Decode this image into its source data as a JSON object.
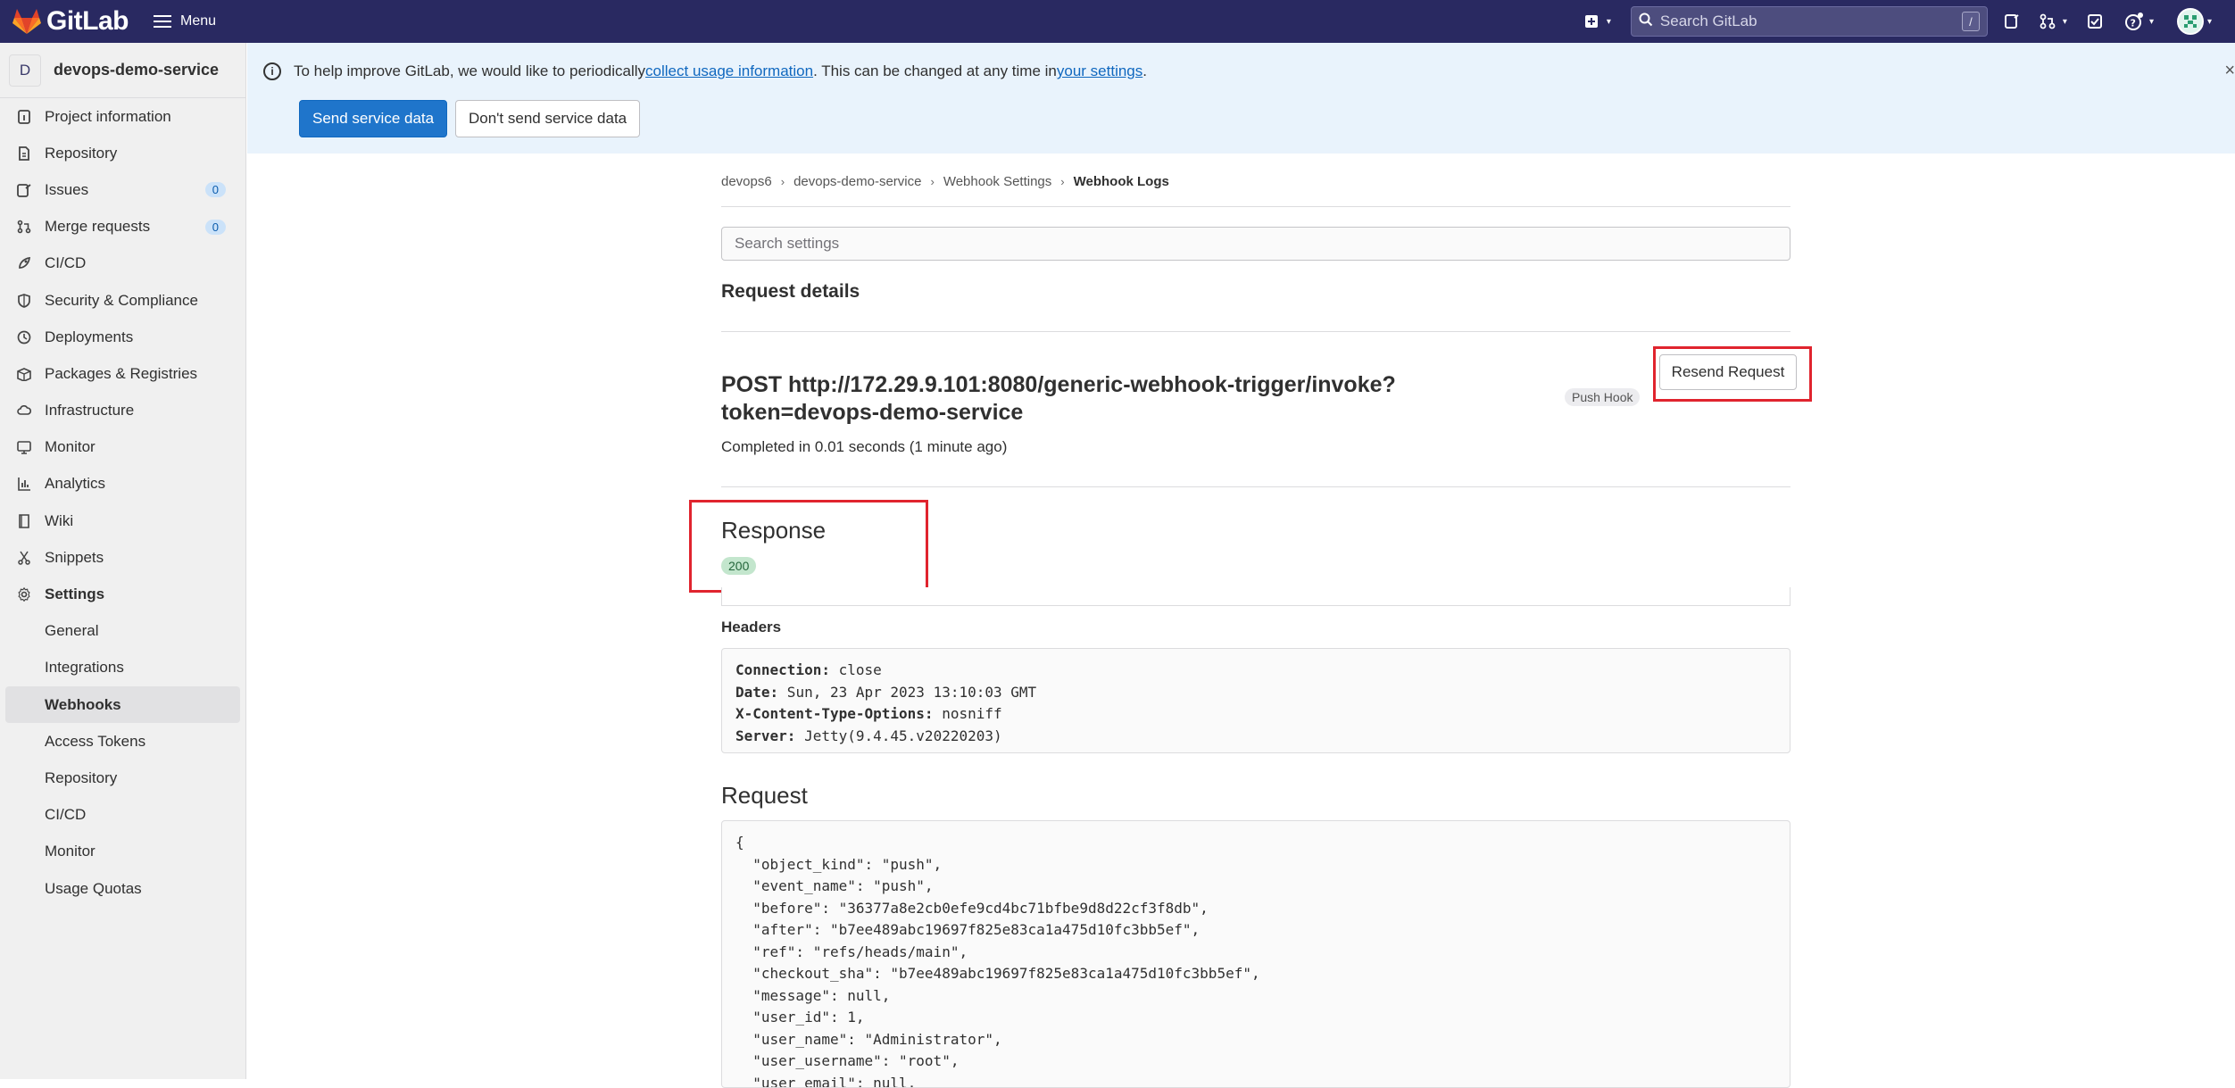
{
  "navbar": {
    "brand": "GitLab",
    "menu_label": "Menu",
    "search_placeholder": "Search GitLab",
    "search_shortcut": "/"
  },
  "sidebar": {
    "project_initial": "D",
    "project_name": "devops-demo-service",
    "items": [
      {
        "label": "Project information",
        "icon": "info-doc-icon"
      },
      {
        "label": "Repository",
        "icon": "doc-icon"
      },
      {
        "label": "Issues",
        "icon": "issues-icon",
        "badge": "0"
      },
      {
        "label": "Merge requests",
        "icon": "merge-request-icon",
        "badge": "0"
      },
      {
        "label": "CI/CD",
        "icon": "rocket-icon"
      },
      {
        "label": "Security & Compliance",
        "icon": "shield-icon"
      },
      {
        "label": "Deployments",
        "icon": "deployments-icon"
      },
      {
        "label": "Packages & Registries",
        "icon": "package-icon"
      },
      {
        "label": "Infrastructure",
        "icon": "cloud-gear-icon"
      },
      {
        "label": "Monitor",
        "icon": "monitor-icon"
      },
      {
        "label": "Analytics",
        "icon": "chart-icon"
      },
      {
        "label": "Wiki",
        "icon": "book-icon"
      },
      {
        "label": "Snippets",
        "icon": "scissors-icon"
      },
      {
        "label": "Settings",
        "icon": "gear-icon"
      }
    ],
    "settings_sub": [
      "General",
      "Integrations",
      "Webhooks",
      "Access Tokens",
      "Repository",
      "CI/CD",
      "Monitor",
      "Usage Quotas"
    ],
    "active_sub": "Webhooks"
  },
  "banner": {
    "text_before": "To help improve GitLab, we would like to periodically ",
    "link1": "collect usage information",
    "text_middle": ". This can be changed at any time in ",
    "link2": "your settings",
    "text_after": ".",
    "send_button": "Send service data",
    "dont_send_button": "Don't send service data"
  },
  "breadcrumb": [
    "devops6",
    "devops-demo-service",
    "Webhook Settings",
    "Webhook Logs"
  ],
  "main": {
    "search_placeholder": "Search settings",
    "request_details_title": "Request details",
    "post_url_line1": "POST http://172.29.9.101:8080/generic-webhook-trigger/invoke?",
    "post_url_line2": "token=devops-demo-service",
    "completed_text": "Completed in 0.01 seconds (1 minute ago)",
    "hook_badge": "Push Hook",
    "resend_button": "Resend Request",
    "response_title": "Response",
    "status_code": "200",
    "headers_label": "Headers",
    "response_headers": [
      {
        "key": "Connection:",
        "value": " close"
      },
      {
        "key": "Date:",
        "value": " Sun, 23 Apr 2023 13:10:03 GMT"
      },
      {
        "key": "X-Content-Type-Options:",
        "value": " nosniff"
      },
      {
        "key": "Server:",
        "value": " Jetty(9.4.45.v20220203)"
      }
    ],
    "request_title": "Request",
    "request_body": "{\n  \"object_kind\": \"push\",\n  \"event_name\": \"push\",\n  \"before\": \"36377a8e2cb0efe9cd4bc71bfbe9d8d22cf3f8db\",\n  \"after\": \"b7ee489abc19697f825e83ca1a475d10fc3bb5ef\",\n  \"ref\": \"refs/heads/main\",\n  \"checkout_sha\": \"b7ee489abc19697f825e83ca1a475d10fc3bb5ef\",\n  \"message\": null,\n  \"user_id\": 1,\n  \"user_name\": \"Administrator\",\n  \"user_username\": \"root\",\n  \"user_email\": null,"
  },
  "colors": {
    "navbar": "#292961",
    "banner": "#e9f3fc",
    "primary": "#1f75cb",
    "highlight_outline": "#e0242e",
    "status_success": "#c3e6cd"
  }
}
